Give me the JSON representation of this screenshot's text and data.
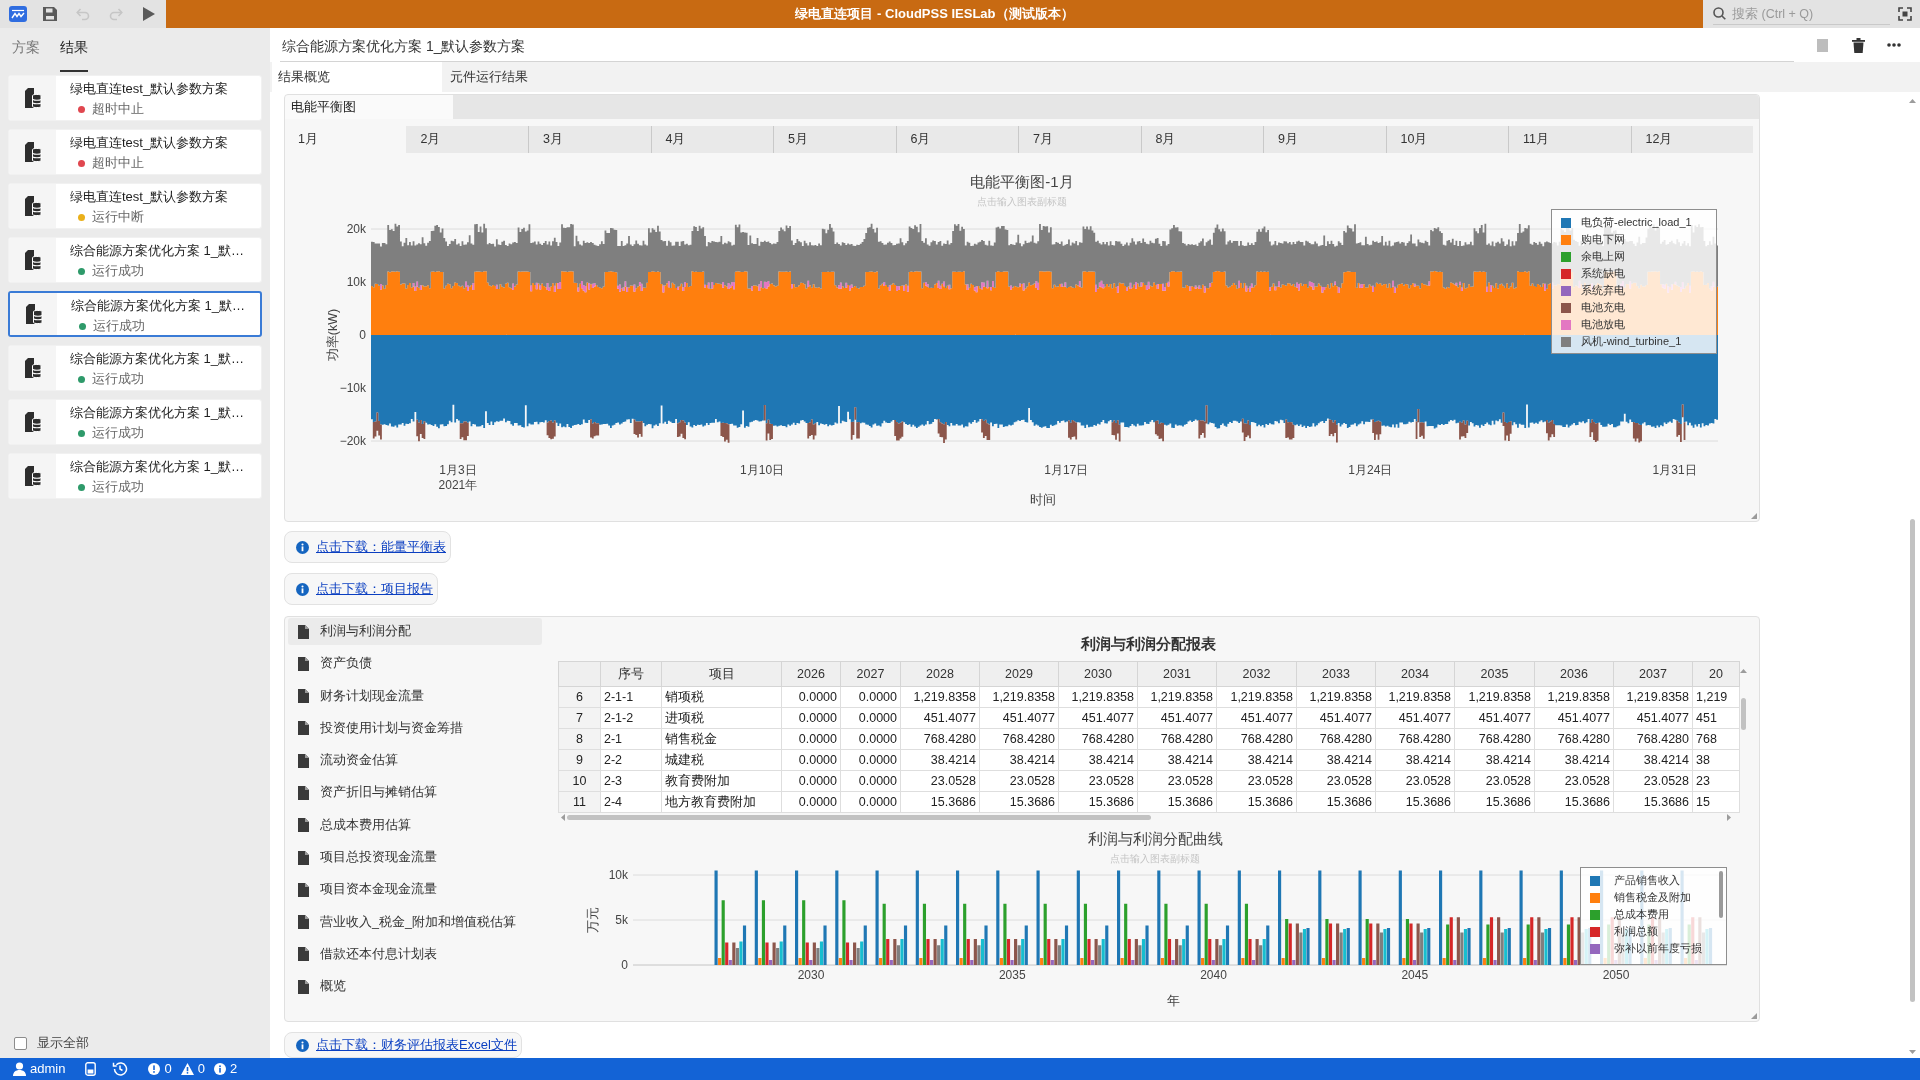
{
  "app_bar": {
    "tools": [
      {
        "kind": "save",
        "disabled": false
      },
      {
        "kind": "undo",
        "disabled": true
      },
      {
        "kind": "redo",
        "disabled": true
      },
      {
        "kind": "run",
        "disabled": false
      }
    ],
    "title": "绿电直连项目 - CloudPSS IESLab（测试版本）",
    "search": {
      "placeholder": "搜索 (Ctrl + Q)"
    }
  },
  "sidebar": {
    "tabs": [
      {
        "label": "方案",
        "selected": false
      },
      {
        "label": "结果",
        "selected": true
      }
    ],
    "items": [
      {
        "title": "绿电直连test_默认参数方案",
        "status": "超时中止",
        "color": "#e0474f",
        "selected": false
      },
      {
        "title": "绿电直连test_默认参数方案",
        "status": "超时中止",
        "color": "#e0474f",
        "selected": false
      },
      {
        "title": "绿电直连test_默认参数方案",
        "status": "运行中断",
        "color": "#eab01a",
        "selected": false
      },
      {
        "title": "综合能源方案优化方案 1_默…",
        "status": "运行成功",
        "color": "#2e9a6a",
        "selected": false
      },
      {
        "title": "综合能源方案优化方案 1_默…",
        "status": "运行成功",
        "color": "#2e9a6a",
        "selected": true
      },
      {
        "title": "综合能源方案优化方案 1_默…",
        "status": "运行成功",
        "color": "#2e9a6a",
        "selected": false
      },
      {
        "title": "综合能源方案优化方案 1_默…",
        "status": "运行成功",
        "color": "#2e9a6a",
        "selected": false
      },
      {
        "title": "综合能源方案优化方案 1_默…",
        "status": "运行成功",
        "color": "#2e9a6a",
        "selected": false
      }
    ],
    "show_all": {
      "label": "显示全部",
      "checked": false
    }
  },
  "main": {
    "title": "综合能源方案优化方案 1_默认参数方案",
    "actions": [
      {
        "kind": "stop",
        "disabled": true
      },
      {
        "kind": "delete",
        "disabled": false
      },
      {
        "kind": "more",
        "disabled": false
      }
    ],
    "tabs": [
      {
        "label": "结果概览",
        "selected": true
      },
      {
        "label": "元件运行结果",
        "selected": false
      }
    ]
  },
  "energy_panel": {
    "tabs": [
      {
        "label": "电能平衡图",
        "selected": true
      }
    ],
    "months": [
      {
        "label": "1月",
        "selected": true
      },
      {
        "label": "2月",
        "selected": false
      },
      {
        "label": "3月",
        "selected": false
      },
      {
        "label": "4月",
        "selected": false
      },
      {
        "label": "5月",
        "selected": false
      },
      {
        "label": "6月",
        "selected": false
      },
      {
        "label": "7月",
        "selected": false
      },
      {
        "label": "8月",
        "selected": false
      },
      {
        "label": "9月",
        "selected": false
      },
      {
        "label": "10月",
        "selected": false
      },
      {
        "label": "11月",
        "selected": false
      },
      {
        "label": "12月",
        "selected": false
      }
    ],
    "chart": {
      "title": "电能平衡图-1月",
      "subtitle": "点击输入图表副标题",
      "ylabel": "功率(kW)",
      "xlabel": "时间",
      "yticks": [
        "20k",
        "10k",
        "0",
        "−10k",
        "−20k"
      ],
      "xticks": [
        {
          "label": "1月3日",
          "year": "2021年"
        },
        {
          "label": "1月10日"
        },
        {
          "label": "1月17日"
        },
        {
          "label": "1月24日"
        },
        {
          "label": "1月31日"
        }
      ],
      "legend": [
        {
          "name": "电负荷-electric_load_1",
          "color": "#1f77b4"
        },
        {
          "name": "购电下网",
          "color": "#ff7f0e"
        },
        {
          "name": "余电上网",
          "color": "#2ca02c"
        },
        {
          "name": "系统缺电",
          "color": "#d62728"
        },
        {
          "name": "系统弃电",
          "color": "#9467bd"
        },
        {
          "name": "电池充电",
          "color": "#8c564b"
        },
        {
          "name": "电池放电",
          "color": "#e377c2"
        },
        {
          "name": "风机-wind_turbine_1",
          "color": "#7f7f7f"
        }
      ]
    }
  },
  "downloads": [
    {
      "label": "点击下载：能量平衡表"
    },
    {
      "label": "点击下载：项目报告"
    }
  ],
  "finance_panel": {
    "menu": [
      {
        "label": "利润与利润分配",
        "selected": true
      },
      {
        "label": "资产负债",
        "selected": false
      },
      {
        "label": "财务计划现金流量",
        "selected": false
      },
      {
        "label": "投资使用计划与资金筹措",
        "selected": false
      },
      {
        "label": "流动资金估算",
        "selected": false
      },
      {
        "label": "资产折旧与摊销估算",
        "selected": false
      },
      {
        "label": "总成本费用估算",
        "selected": false
      },
      {
        "label": "项目总投资现金流量",
        "selected": false
      },
      {
        "label": "项目资本金现金流量",
        "selected": false
      },
      {
        "label": "营业收入_税金_附加和增值税估算",
        "selected": false
      },
      {
        "label": "借款还本付息计划表",
        "selected": false
      },
      {
        "label": "概览",
        "selected": false
      }
    ],
    "table": {
      "title": "利润与利润分配报表",
      "columns": [
        "序号",
        "项目",
        "2026",
        "2027",
        "2028",
        "2029",
        "2030",
        "2031",
        "2032",
        "2033",
        "2034",
        "2035",
        "2036",
        "2037",
        "20"
      ],
      "rows": [
        {
          "index": "6",
          "cells": [
            "2-1-1",
            "销项税",
            "0.0000",
            "0.0000",
            "1,219.8358",
            "1,219.8358",
            "1,219.8358",
            "1,219.8358",
            "1,219.8358",
            "1,219.8358",
            "1,219.8358",
            "1,219.8358",
            "1,219.8358",
            "1,219.8358",
            "1,219"
          ]
        },
        {
          "index": "7",
          "cells": [
            "2-1-2",
            "进项税",
            "0.0000",
            "0.0000",
            "451.4077",
            "451.4077",
            "451.4077",
            "451.4077",
            "451.4077",
            "451.4077",
            "451.4077",
            "451.4077",
            "451.4077",
            "451.4077",
            "451"
          ]
        },
        {
          "index": "8",
          "cells": [
            "2-1",
            "销售税金",
            "0.0000",
            "0.0000",
            "768.4280",
            "768.4280",
            "768.4280",
            "768.4280",
            "768.4280",
            "768.4280",
            "768.4280",
            "768.4280",
            "768.4280",
            "768.4280",
            "768"
          ]
        },
        {
          "index": "9",
          "cells": [
            "2-2",
            "城建税",
            "0.0000",
            "0.0000",
            "38.4214",
            "38.4214",
            "38.4214",
            "38.4214",
            "38.4214",
            "38.4214",
            "38.4214",
            "38.4214",
            "38.4214",
            "38.4214",
            "38"
          ]
        },
        {
          "index": "10",
          "cells": [
            "2-3",
            "教育费附加",
            "0.0000",
            "0.0000",
            "23.0528",
            "23.0528",
            "23.0528",
            "23.0528",
            "23.0528",
            "23.0528",
            "23.0528",
            "23.0528",
            "23.0528",
            "23.0528",
            "23"
          ]
        },
        {
          "index": "11",
          "cells": [
            "2-4",
            "地方教育费附加",
            "0.0000",
            "0.0000",
            "15.3686",
            "15.3686",
            "15.3686",
            "15.3686",
            "15.3686",
            "15.3686",
            "15.3686",
            "15.3686",
            "15.3686",
            "15.3686",
            "15"
          ]
        }
      ]
    },
    "chart": {
      "title": "利润与利润分配曲线",
      "subtitle": "点击输入图表副标题",
      "ylabel": "万元",
      "xlabel": "年",
      "yticks": [
        "10k",
        "5k",
        "0"
      ],
      "xticks": [
        "2030",
        "2035",
        "2040",
        "2045",
        "2050"
      ],
      "legend": [
        {
          "name": "产品销售收入",
          "color": "#1f77b4"
        },
        {
          "name": "销售税金及附加",
          "color": "#ff7f0e"
        },
        {
          "name": "总成本费用",
          "color": "#2ca02c"
        },
        {
          "name": "利润总额",
          "color": "#d62728"
        },
        {
          "name": "弥补以前年度亏损",
          "color": "#9467bd"
        }
      ]
    }
  },
  "finance_download": {
    "label": "点击下载：财务评估报表Excel文件"
  },
  "status_bar": {
    "user": "admin",
    "counts": [
      {
        "kind": "error",
        "count": "0"
      },
      {
        "kind": "warning",
        "count": "0"
      },
      {
        "kind": "info",
        "count": "2"
      }
    ]
  }
}
